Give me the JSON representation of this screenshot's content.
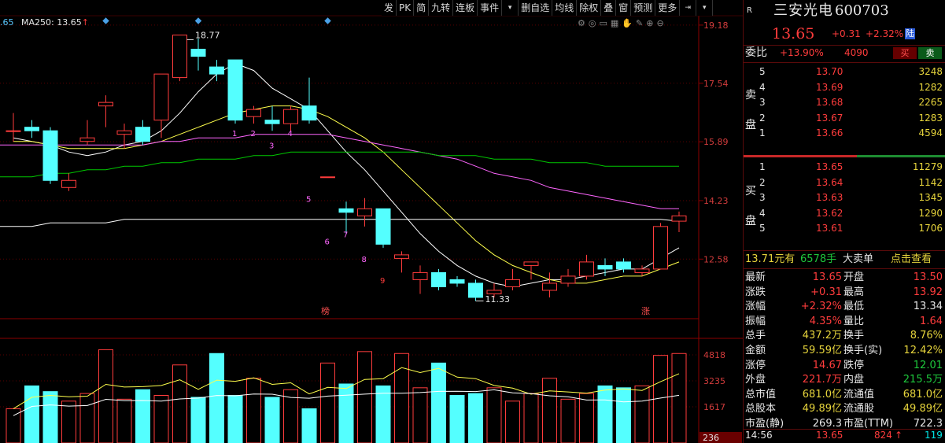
{
  "toolbar": {
    "items": [
      "发",
      "PK",
      "简",
      "九转",
      "连板",
      "事件",
      "删自选",
      "均线",
      "除权",
      "叠",
      "窗",
      "预测",
      "更多"
    ]
  },
  "indicator": {
    "prefix": ".65",
    "ma250": "MA250: 13.65",
    "arrow": "↑"
  },
  "price_axis": [
    "19.18",
    "17.54",
    "15.89",
    "14.23",
    "12.58"
  ],
  "volume_axis": [
    "4818",
    "3235",
    "1617"
  ],
  "volume_bottom": "236",
  "annotations": {
    "high": "18.77",
    "low": "11.33",
    "bang": "榜",
    "zhang": "涨",
    "nums": [
      "1",
      "2",
      "3",
      "4",
      "5",
      "6",
      "7",
      "8",
      "9"
    ]
  },
  "colors": {
    "up": "#ff3c3c",
    "down": "#54ffff",
    "ma5": "#ffffff",
    "ma10": "#ffff4c",
    "ma20": "#ff66ff",
    "ma60": "#00c800",
    "ma250": "#ffffff",
    "grid": "#8b0000"
  },
  "chart_data": {
    "type": "candlestick",
    "ylim": [
      10.9,
      19.4
    ],
    "candles": [
      {
        "o": 16.2,
        "c": 16.2,
        "h": 16.7,
        "l": 15.9
      },
      {
        "o": 16.3,
        "c": 16.2,
        "h": 16.5,
        "l": 16.0
      },
      {
        "o": 16.2,
        "c": 14.8,
        "h": 16.3,
        "l": 14.7
      },
      {
        "o": 14.6,
        "c": 14.8,
        "h": 15.0,
        "l": 14.5
      },
      {
        "o": 15.9,
        "c": 16.0,
        "h": 16.5,
        "l": 15.8
      },
      {
        "o": 16.9,
        "c": 17.0,
        "h": 17.2,
        "l": 16.3
      },
      {
        "o": 16.1,
        "c": 16.2,
        "h": 16.4,
        "l": 15.7
      },
      {
        "o": 16.3,
        "c": 15.9,
        "h": 16.5,
        "l": 15.8
      },
      {
        "o": 16.5,
        "c": 17.8,
        "h": 17.8,
        "l": 16.0
      },
      {
        "o": 17.7,
        "c": 18.9,
        "h": 18.9,
        "l": 17.6
      },
      {
        "o": 18.5,
        "c": 18.3,
        "h": 18.8,
        "l": 17.9
      },
      {
        "o": 18.0,
        "c": 17.8,
        "h": 18.2,
        "l": 17.6
      },
      {
        "o": 18.2,
        "c": 16.5,
        "h": 18.2,
        "l": 16.4
      },
      {
        "o": 16.6,
        "c": 16.8,
        "h": 16.9,
        "l": 16.4
      },
      {
        "o": 16.5,
        "c": 16.4,
        "h": 16.9,
        "l": 16.2
      },
      {
        "o": 16.4,
        "c": 16.8,
        "h": 16.9,
        "l": 16.2
      },
      {
        "o": 16.9,
        "c": 16.5,
        "h": 17.7,
        "l": 16.4
      },
      {
        "o": 14.9,
        "c": 14.9,
        "h": 14.9,
        "l": 14.9
      },
      {
        "o": 14.0,
        "c": 13.9,
        "h": 14.2,
        "l": 13.3
      },
      {
        "o": 13.8,
        "c": 14.0,
        "h": 14.3,
        "l": 13.5
      },
      {
        "o": 14.0,
        "c": 13.0,
        "h": 14.0,
        "l": 12.9
      },
      {
        "o": 12.6,
        "c": 12.7,
        "h": 12.8,
        "l": 12.2
      },
      {
        "o": 12.0,
        "c": 12.2,
        "h": 12.4,
        "l": 11.6
      },
      {
        "o": 12.2,
        "c": 11.8,
        "h": 12.3,
        "l": 11.7
      },
      {
        "o": 12.0,
        "c": 11.9,
        "h": 12.1,
        "l": 11.8
      },
      {
        "o": 11.9,
        "c": 11.5,
        "h": 12.0,
        "l": 11.4
      },
      {
        "o": 11.6,
        "c": 11.7,
        "h": 11.9,
        "l": 11.5
      },
      {
        "o": 11.8,
        "c": 12.0,
        "h": 12.3,
        "l": 11.7
      },
      {
        "o": 12.4,
        "c": 12.5,
        "h": 12.5,
        "l": 12.0
      },
      {
        "o": 11.7,
        "c": 11.9,
        "h": 12.2,
        "l": 11.5
      },
      {
        "o": 11.9,
        "c": 12.1,
        "h": 12.3,
        "l": 11.8
      },
      {
        "o": 12.1,
        "c": 12.5,
        "h": 12.7,
        "l": 12.0
      },
      {
        "o": 12.4,
        "c": 12.3,
        "h": 12.6,
        "l": 12.1
      },
      {
        "o": 12.5,
        "c": 12.3,
        "h": 12.6,
        "l": 12.2
      },
      {
        "o": 12.2,
        "c": 12.3,
        "h": 12.4,
        "l": 12.1
      },
      {
        "o": 12.3,
        "c": 13.5,
        "h": 13.6,
        "l": 12.3
      },
      {
        "o": 13.65,
        "c": 13.8,
        "h": 13.92,
        "l": 13.34
      }
    ],
    "volumes": [
      180,
      300,
      270,
      220,
      260,
      490,
      230,
      280,
      250,
      410,
      240,
      470,
      250,
      340,
      240,
      280,
      180,
      420,
      310,
      480,
      300,
      470,
      290,
      420,
      250,
      260,
      290,
      220,
      260,
      340,
      230,
      260,
      300,
      290,
      300,
      460,
      470
    ],
    "ma_lines": [
      {
        "name": "MA5",
        "values": [
          16.0,
          15.9,
          15.8,
          15.6,
          15.5,
          15.6,
          15.8,
          15.9,
          16.2,
          16.7,
          17.3,
          17.8,
          18.1,
          17.9,
          17.4,
          17.1,
          16.8,
          16.2,
          15.6,
          15.1,
          14.5,
          13.9,
          13.3,
          12.8,
          12.4,
          12.1,
          11.9,
          11.8,
          11.9,
          12.0,
          12.0,
          12.1,
          12.2,
          12.3,
          12.3,
          12.6,
          12.9
        ]
      },
      {
        "name": "MA10",
        "values": [
          15.9,
          15.9,
          15.8,
          15.7,
          15.7,
          15.7,
          15.7,
          15.8,
          15.9,
          16.1,
          16.3,
          16.5,
          16.7,
          16.8,
          16.9,
          16.9,
          16.8,
          16.6,
          16.3,
          16.0,
          15.6,
          15.1,
          14.6,
          14.1,
          13.6,
          13.1,
          12.7,
          12.4,
          12.2,
          12.0,
          11.9,
          11.9,
          12.0,
          12.1,
          12.1,
          12.3,
          12.5
        ]
      },
      {
        "name": "MA20",
        "values": [
          15.8,
          15.8,
          15.8,
          15.8,
          15.8,
          15.8,
          15.8,
          15.8,
          15.9,
          15.9,
          16.0,
          16.0,
          16.0,
          16.1,
          16.1,
          16.1,
          16.1,
          16.1,
          16.0,
          15.9,
          15.8,
          15.7,
          15.6,
          15.5,
          15.4,
          15.2,
          15.0,
          14.9,
          14.8,
          14.6,
          14.5,
          14.4,
          14.3,
          14.2,
          14.1,
          14.0,
          14.0
        ]
      },
      {
        "name": "MA60",
        "values": [
          14.9,
          14.9,
          15.0,
          15.0,
          15.1,
          15.1,
          15.2,
          15.2,
          15.3,
          15.3,
          15.4,
          15.4,
          15.4,
          15.5,
          15.5,
          15.6,
          15.6,
          15.6,
          15.6,
          15.6,
          15.6,
          15.6,
          15.6,
          15.5,
          15.5,
          15.5,
          15.4,
          15.4,
          15.4,
          15.3,
          15.3,
          15.3,
          15.2,
          15.2,
          15.2,
          15.2,
          15.2
        ]
      },
      {
        "name": "MA250",
        "values": [
          13.5,
          13.5,
          13.6,
          13.6,
          13.6,
          13.6,
          13.7,
          13.7,
          13.7,
          13.7,
          13.7,
          13.7,
          13.7,
          13.7,
          13.7,
          13.7,
          13.7,
          13.7,
          13.7,
          13.7,
          13.7,
          13.7,
          13.7,
          13.7,
          13.7,
          13.7,
          13.7,
          13.7,
          13.7,
          13.7,
          13.7,
          13.7,
          13.7,
          13.7,
          13.7,
          13.7,
          13.65
        ]
      }
    ]
  },
  "stock": {
    "name": "三安光电",
    "code": "600703",
    "price": "13.65",
    "change": "+0.31",
    "pct": "+2.32%",
    "exchange": "陆",
    "wei_label": "委比",
    "wei_pct": "+13.90%",
    "wei_diff": "4090",
    "buy_btn": "买",
    "sell_btn": "卖",
    "sell_label": [
      "卖",
      "盘"
    ],
    "buy_label": [
      "买",
      "盘"
    ],
    "asks": [
      {
        "lvl": "5",
        "price": "13.70",
        "vol": "3248"
      },
      {
        "lvl": "4",
        "price": "13.69",
        "vol": "1282"
      },
      {
        "lvl": "3",
        "price": "13.68",
        "vol": "2265"
      },
      {
        "lvl": "2",
        "price": "13.67",
        "vol": "1283"
      },
      {
        "lvl": "1",
        "price": "13.66",
        "vol": "4594"
      }
    ],
    "bids": [
      {
        "lvl": "1",
        "price": "13.65",
        "vol": "11279"
      },
      {
        "lvl": "2",
        "price": "13.64",
        "vol": "1142"
      },
      {
        "lvl": "3",
        "price": "13.63",
        "vol": "1345"
      },
      {
        "lvl": "4",
        "price": "13.62",
        "vol": "1290"
      },
      {
        "lvl": "5",
        "price": "13.61",
        "vol": "1706"
      }
    ],
    "big_order": {
      "amount": "13.71元有",
      "hands": "6578手",
      "label": "大卖单",
      "link": "点击查看"
    },
    "quotes": [
      {
        "l1": "最新",
        "v1": "13.65",
        "c1": "red",
        "l2": "开盘",
        "v2": "13.50",
        "c2": "red"
      },
      {
        "l1": "涨跌",
        "v1": "+0.31",
        "c1": "red",
        "l2": "最高",
        "v2": "13.92",
        "c2": "red"
      },
      {
        "l1": "涨幅",
        "v1": "+2.32%",
        "c1": "red",
        "l2": "最低",
        "v2": "13.34",
        "c2": "white"
      },
      {
        "l1": "振幅",
        "v1": "4.35%",
        "c1": "red",
        "l2": "量比",
        "v2": "1.64",
        "c2": "red"
      },
      {
        "l1": "总手",
        "v1": "437.2万",
        "c1": "yellow",
        "l2": "换手",
        "v2": "8.76%",
        "c2": "yellow"
      },
      {
        "l1": "金额",
        "v1": "59.59亿",
        "c1": "yellow",
        "l2": "换手(实)",
        "v2": "12.42%",
        "c2": "yellow"
      },
      {
        "l1": "涨停",
        "v1": "14.67",
        "c1": "red",
        "l2": "跌停",
        "v2": "12.01",
        "c2": "green"
      },
      {
        "l1": "外盘",
        "v1": "221.7万",
        "c1": "red",
        "l2": "内盘",
        "v2": "215.5万",
        "c2": "green"
      },
      {
        "l1": "总市值",
        "v1": "681.0亿",
        "c1": "yellow",
        "l2": "流通值",
        "v2": "681.0亿",
        "c2": "yellow"
      },
      {
        "l1": "总股本",
        "v1": "49.89亿",
        "c1": "yellow",
        "l2": "流通股",
        "v2": "49.89亿",
        "c2": "yellow"
      },
      {
        "l1": "市盈(静)",
        "v1": "269.3",
        "c1": "white",
        "l2": "市盈(TTM)",
        "v2": "722.3",
        "c2": "white"
      }
    ],
    "tick": {
      "time": "14:56",
      "price": "13.65",
      "vol": "824",
      "arrow": "↑",
      "count": "119"
    }
  }
}
